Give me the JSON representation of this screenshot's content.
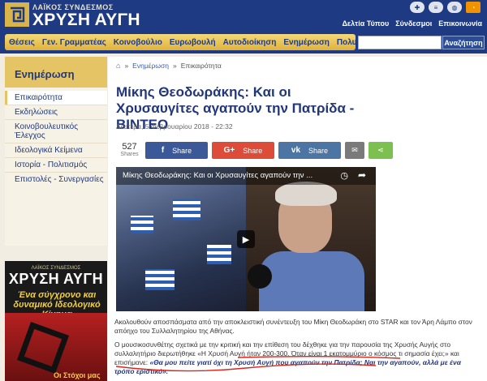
{
  "header": {
    "logo_small": "ΛΑΪΚΟΣ ΣΥΝΔΕΣΜΟΣ",
    "logo_big": "ΧΡΥΣΗ ΑΥΓΗ",
    "flags": [
      "uk-flag",
      "greek-flag",
      "globe-icon",
      "rss-icon"
    ],
    "top_links": [
      "Δελτία Τύπου",
      "Σύνδεσμοι",
      "Επικοινωνία"
    ]
  },
  "nav": {
    "items": [
      "Θέσεις",
      "Γεν. Γραμματέας",
      "Κοινοβούλιο",
      "Ευρωβουλή",
      "Αυτοδιοίκηση",
      "Ενημέρωση",
      "Πολυμέσα"
    ],
    "search_placeholder": "",
    "search_button": "Αναζήτηση"
  },
  "sidebar": {
    "title": "Ενημέρωση",
    "items": [
      {
        "label": "Επικαιρότητα",
        "active": true
      },
      {
        "label": "Εκδηλώσεις",
        "active": false
      },
      {
        "label": "Κοινοβουλευτικός Έλεγχος",
        "active": false
      },
      {
        "label": "Ιδεολογικά Κείμενα",
        "active": false
      },
      {
        "label": "Ιστορία - Πολιτισμός",
        "active": false
      },
      {
        "label": "Επιστολές - Συνεργασίες",
        "active": false
      }
    ],
    "ad": {
      "small": "ΛΑΪΚΟΣ ΣΥΝΔΕΣΜΟΣ",
      "big": "ΧΡΥΣΗ ΑΥΓΗ",
      "tagline": "Ένα σύγχρονο και δυναμικό Ιδεολογικό Κίνημα",
      "bottom": "Οι Στόχοι μας"
    }
  },
  "article": {
    "breadcrumb": [
      "Ενημέρωση",
      "Επικαιρότητα"
    ],
    "title": "Μίκης Θεοδωράκης: Και οι Χρυσαυγίτες αγαπούν την Πατρίδα - ΒΙΝΤΕΟ",
    "date": "Δευτέρα, 5 Φεβρουαρίου 2018 - 22:32",
    "share": {
      "count": "527",
      "count_label": "Shares",
      "facebook": "Share",
      "google": "Share",
      "vk": "Share"
    },
    "video_title": "Μίκης Θεοδωράκης: Και οι Χρυσαυγίτες αγαπούν την ...",
    "paragraph1": "Ακολουθούν αποσπάσματα από την αποκλειστική συνέντευξη του Μίκη Θεοδωράκη στο STAR και τον Άρη Λάμπο στον απόηχο του Συλλαλητηρίου της Αθήνας.",
    "paragraph2_plain": "Ο μουσικοσυνθέτης σχετικά με την κριτική και την επίθεση του δέχθηκε για την παρουσία της Χρυσής Αυγής στο συλλαλητήριο διερωτήθηκε «Η Χρυσή Αυγή ήταν 200-300. Όταν είναι 1 εκατομμύριο ο κόσμος τι σημασία έχει;» και επισήμανε:",
    "paragraph2_quote": "«Θα μου πείτε γιατί όχι τη Χρυσή Αυγή που αγαπούν την Πατρίδα; Ναι την αγαπούν, αλλά με ένα τρόπο εριστικό»."
  },
  "colors": {
    "header_blue": "#1e3a82",
    "nav_gold": "#e1b13a",
    "facebook": "#3b5998",
    "google": "#dd4b39",
    "vk": "#4c75a3",
    "underline_red": "#d8281e"
  }
}
